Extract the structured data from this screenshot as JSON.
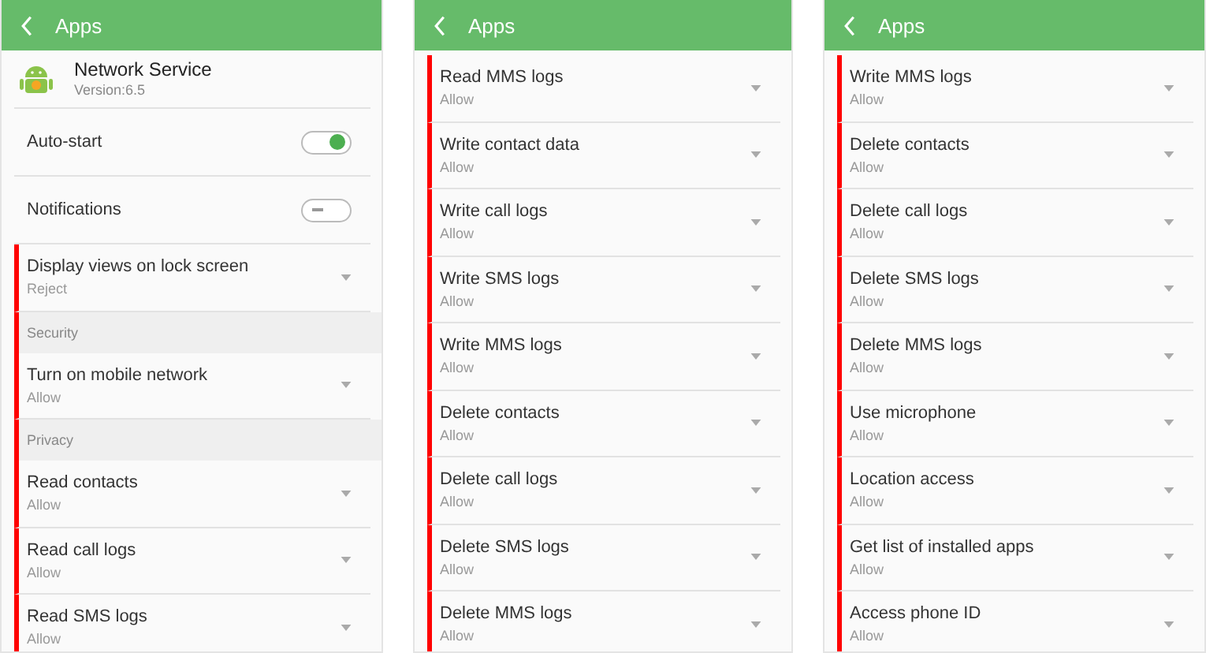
{
  "screens": [
    {
      "title": "Apps",
      "items": [
        {
          "kind": "app-info",
          "name": "Network Service",
          "version": "Version:6.5",
          "flagged": false
        },
        {
          "kind": "toggle",
          "label": "Auto-start",
          "on": true,
          "flagged": false
        },
        {
          "kind": "toggle",
          "label": "Notifications",
          "on": false,
          "flagged": false
        },
        {
          "kind": "dropdown",
          "label": "Display views on lock screen",
          "value": "Reject",
          "flagged": true
        },
        {
          "kind": "section",
          "label": "Security",
          "flagged": true
        },
        {
          "kind": "dropdown",
          "label": "Turn on mobile network",
          "value": "Allow",
          "flagged": true
        },
        {
          "kind": "section",
          "label": "Privacy",
          "flagged": true
        },
        {
          "kind": "dropdown",
          "label": "Read contacts",
          "value": "Allow",
          "flagged": true
        },
        {
          "kind": "dropdown",
          "label": "Read call logs",
          "value": "Allow",
          "flagged": true
        },
        {
          "kind": "dropdown",
          "label": "Read SMS logs",
          "value": "Allow",
          "flagged": true
        }
      ]
    },
    {
      "title": "Apps",
      "items": [
        {
          "kind": "dropdown",
          "label": "Read MMS logs",
          "value": "Allow",
          "flagged": true
        },
        {
          "kind": "dropdown",
          "label": "Write contact data",
          "value": "Allow",
          "flagged": true
        },
        {
          "kind": "dropdown",
          "label": "Write call logs",
          "value": "Allow",
          "flagged": true
        },
        {
          "kind": "dropdown",
          "label": "Write SMS logs",
          "value": "Allow",
          "flagged": true
        },
        {
          "kind": "dropdown",
          "label": "Write MMS logs",
          "value": "Allow",
          "flagged": true
        },
        {
          "kind": "dropdown",
          "label": "Delete contacts",
          "value": "Allow",
          "flagged": true
        },
        {
          "kind": "dropdown",
          "label": "Delete call logs",
          "value": "Allow",
          "flagged": true
        },
        {
          "kind": "dropdown",
          "label": "Delete SMS logs",
          "value": "Allow",
          "flagged": true
        },
        {
          "kind": "dropdown",
          "label": "Delete MMS logs",
          "value": "Allow",
          "flagged": true
        }
      ]
    },
    {
      "title": "Apps",
      "items": [
        {
          "kind": "dropdown",
          "label": "Write MMS logs",
          "value": "Allow",
          "flagged": true
        },
        {
          "kind": "dropdown",
          "label": "Delete contacts",
          "value": "Allow",
          "flagged": true
        },
        {
          "kind": "dropdown",
          "label": "Delete call logs",
          "value": "Allow",
          "flagged": true
        },
        {
          "kind": "dropdown",
          "label": "Delete SMS logs",
          "value": "Allow",
          "flagged": true
        },
        {
          "kind": "dropdown",
          "label": "Delete MMS logs",
          "value": "Allow",
          "flagged": true
        },
        {
          "kind": "dropdown",
          "label": "Use microphone",
          "value": "Allow",
          "flagged": true
        },
        {
          "kind": "dropdown",
          "label": "Location access",
          "value": "Allow",
          "flagged": true
        },
        {
          "kind": "dropdown",
          "label": "Get list of installed apps",
          "value": "Allow",
          "flagged": true
        },
        {
          "kind": "dropdown",
          "label": "Access phone ID",
          "value": "Allow",
          "flagged": true
        }
      ]
    }
  ]
}
